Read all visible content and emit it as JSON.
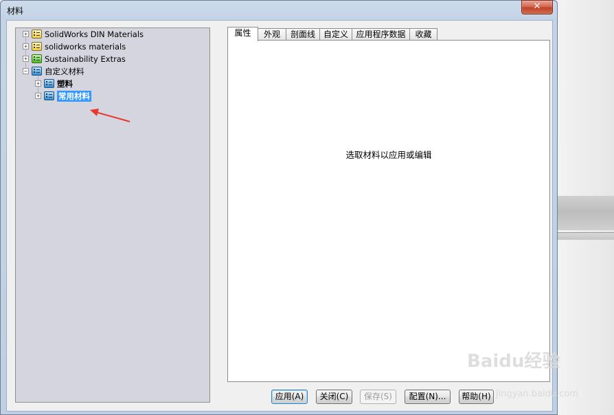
{
  "window": {
    "title": "材料",
    "close_glyph": "✕"
  },
  "tree": {
    "items": [
      {
        "label": "SolidWorks DIN Materials",
        "expander": "+",
        "icon": "yellow"
      },
      {
        "label": "solidworks materials",
        "expander": "+",
        "icon": "yellow"
      },
      {
        "label": "Sustainability Extras",
        "expander": "+",
        "icon": "green"
      },
      {
        "label": "自定义材料",
        "expander": "−",
        "icon": "blue"
      },
      {
        "label": "塑料",
        "expander": "+",
        "icon": "blue"
      },
      {
        "label": "常用材料",
        "expander": "+",
        "icon": "blue",
        "selected": true
      }
    ]
  },
  "tabs": [
    {
      "label": "属性",
      "active": true
    },
    {
      "label": "外观"
    },
    {
      "label": "剖面线"
    },
    {
      "label": "自定义"
    },
    {
      "label": "应用程序数据"
    },
    {
      "label": "收藏"
    }
  ],
  "panel": {
    "message": "选取材料以应用或编辑"
  },
  "buttons": {
    "apply": "应用(A)",
    "close": "关闭(C)",
    "save": "保存(S)",
    "config": "配置(N)...",
    "help": "帮助(H)"
  },
  "watermark": {
    "text": "Baidu经验",
    "sub": "jingyan.baidu.com"
  },
  "colors": {
    "selection": "#3399ff",
    "annotation_arrow": "#e8392f",
    "tree_bg": "#d4d5de"
  }
}
